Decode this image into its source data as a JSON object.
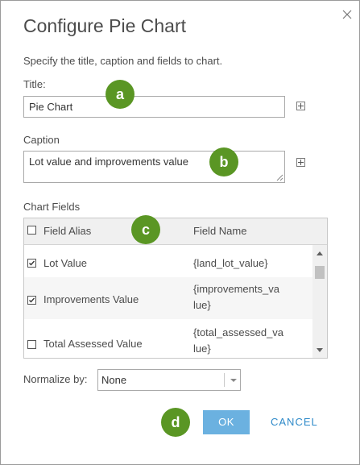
{
  "dialog": {
    "title": "Configure Pie Chart",
    "instructions": "Specify the title, caption and fields to chart."
  },
  "title_field": {
    "label": "Title:",
    "value": "Pie Chart"
  },
  "caption_field": {
    "label": "Caption",
    "value": "Lot value and improvements value"
  },
  "chart_fields": {
    "label": "Chart Fields",
    "headers": {
      "alias": "Field Alias",
      "name": "Field Name"
    },
    "rows": [
      {
        "alias": "Lot Value",
        "name_line1": "{land_lot_value}",
        "name_line2": "",
        "checked": true
      },
      {
        "alias": "Improvements Value",
        "name_line1": "{improvements_va",
        "name_line2": "lue}",
        "checked": true
      },
      {
        "alias": "Total Assessed Value",
        "name_line1": "{total_assessed_va",
        "name_line2": "lue}",
        "checked": false
      }
    ]
  },
  "normalize": {
    "label": "Normalize by:",
    "selected": "None"
  },
  "buttons": {
    "ok": "OK",
    "cancel": "CANCEL"
  },
  "badges": {
    "a": "a",
    "b": "b",
    "c": "c",
    "d": "d"
  },
  "colors": {
    "badge": "#5a9624",
    "ok_button": "#6bb1e0",
    "cancel_text": "#2e8ac9"
  },
  "icons": {
    "close": "close-icon",
    "expand": "plus-icon",
    "check": "checkmark-icon"
  }
}
